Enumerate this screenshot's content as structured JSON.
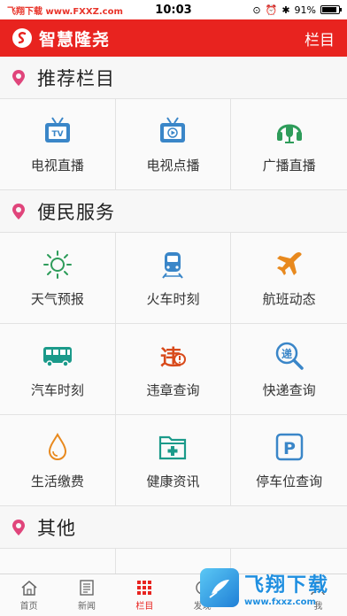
{
  "status_bar": {
    "source_watermark": "飞翔下载 www.FXXZ.com",
    "time": "10:03",
    "battery": "91%",
    "battery_level": 0.91
  },
  "app_bar": {
    "title": "智慧隆尧",
    "logo_glyph": "S",
    "menu_label": "栏目",
    "color": "#e8231f"
  },
  "sections": [
    {
      "title": "推荐栏目",
      "items": [
        {
          "label": "电视直播",
          "icon": "tv-live-icon"
        },
        {
          "label": "电视点播",
          "icon": "tv-vod-icon"
        },
        {
          "label": "广播直播",
          "icon": "radio-headset-icon"
        }
      ]
    },
    {
      "title": "便民服务",
      "items": [
        {
          "label": "天气预报",
          "icon": "sun-icon"
        },
        {
          "label": "火车时刻",
          "icon": "train-icon"
        },
        {
          "label": "航班动态",
          "icon": "airplane-icon"
        },
        {
          "label": "汽车时刻",
          "icon": "bus-icon"
        },
        {
          "label": "违章查询",
          "icon": "violation-icon"
        },
        {
          "label": "快递查询",
          "icon": "express-icon"
        },
        {
          "label": "生活缴费",
          "icon": "water-drop-icon"
        },
        {
          "label": "健康资讯",
          "icon": "health-folder-icon"
        },
        {
          "label": "停车位查询",
          "icon": "parking-icon"
        }
      ]
    },
    {
      "title": "其他",
      "items": []
    }
  ],
  "tab_bar": {
    "tabs": [
      {
        "label": "首页",
        "icon": "home-icon"
      },
      {
        "label": "新闻",
        "icon": "news-icon"
      },
      {
        "label": "栏目",
        "icon": "grid-icon"
      },
      {
        "label": "发现",
        "icon": "discover-icon"
      },
      {
        "label": "",
        "icon": "blank-icon"
      },
      {
        "label": "我",
        "icon": "user-icon"
      }
    ],
    "active_index": 2
  },
  "watermark": {
    "big": "飞翔下载",
    "small": "www.fxxz.com"
  },
  "colors": {
    "accent": "#e8231f",
    "icon_blue": "#3a86c8",
    "icon_green": "#2e9c5a",
    "icon_orange": "#e8891e",
    "icon_teal": "#1b9a8a",
    "pin": "#e0457b"
  }
}
